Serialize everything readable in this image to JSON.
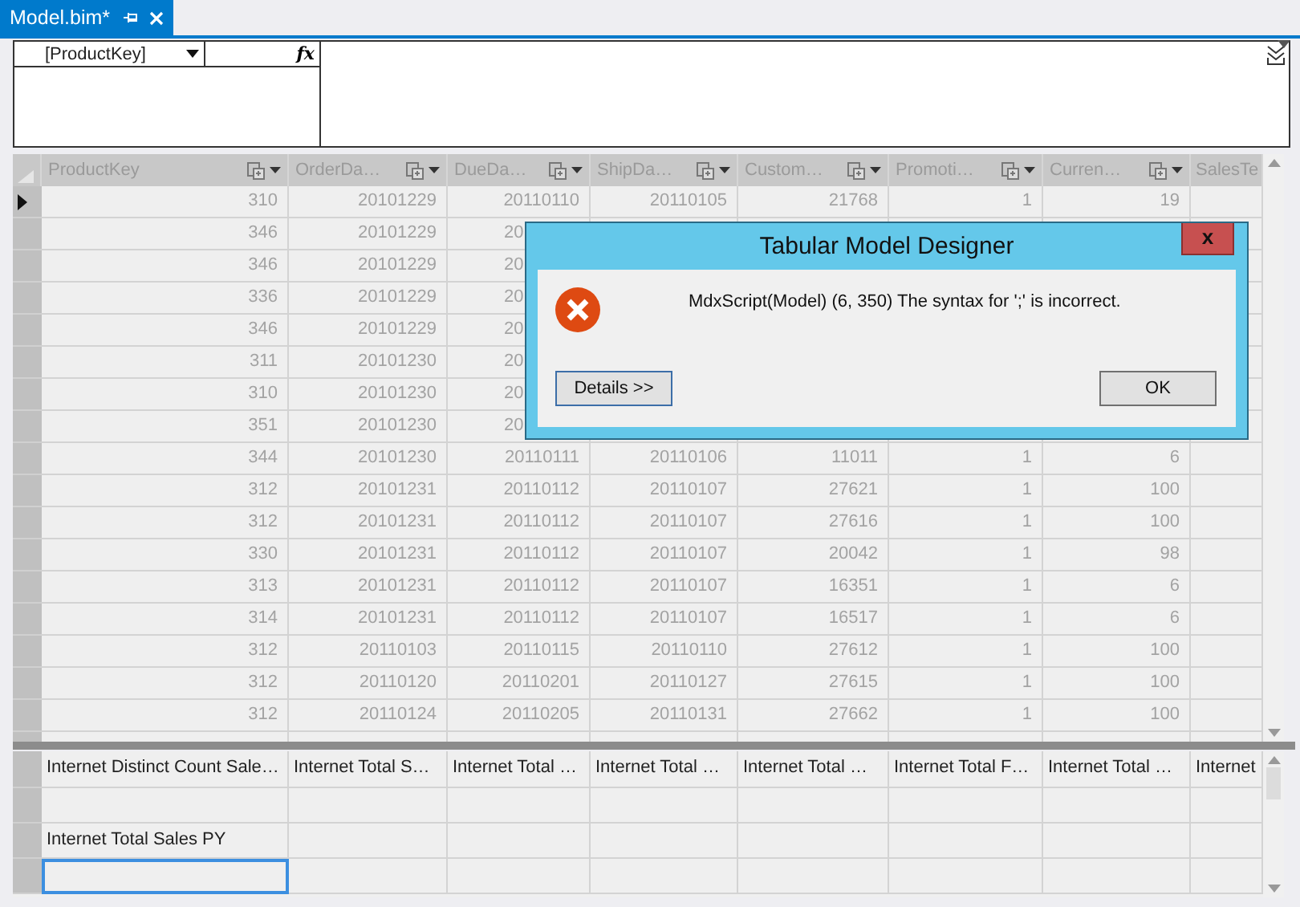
{
  "tab": {
    "title": "Model.bim*",
    "selected": true
  },
  "formula_bar": {
    "column_selector": "[ProductKey]",
    "fx": "fx"
  },
  "grid": {
    "columns": [
      "ProductKey",
      "OrderDa…",
      "DueDa…",
      "ShipDa…",
      "Custom…",
      "Promoti…",
      "Curren…",
      "SalesTe"
    ],
    "rows": [
      {
        "selected": true,
        "cells": [
          "310",
          "20101229",
          "20110110",
          "20110105",
          "21768",
          "1",
          "19"
        ]
      },
      {
        "selected": false,
        "cells": [
          "346",
          "20101229",
          "20"
        ]
      },
      {
        "selected": false,
        "cells": [
          "346",
          "20101229",
          "20"
        ]
      },
      {
        "selected": false,
        "cells": [
          "336",
          "20101229",
          "20"
        ]
      },
      {
        "selected": false,
        "cells": [
          "346",
          "20101229",
          "20"
        ]
      },
      {
        "selected": false,
        "cells": [
          "311",
          "20101230",
          "20"
        ]
      },
      {
        "selected": false,
        "cells": [
          "310",
          "20101230",
          "20"
        ]
      },
      {
        "selected": false,
        "cells": [
          "351",
          "20101230",
          "20"
        ]
      },
      {
        "selected": false,
        "cells": [
          "344",
          "20101230",
          "20110111",
          "20110106",
          "11011",
          "1",
          "6"
        ]
      },
      {
        "selected": false,
        "cells": [
          "312",
          "20101231",
          "20110112",
          "20110107",
          "27621",
          "1",
          "100"
        ]
      },
      {
        "selected": false,
        "cells": [
          "312",
          "20101231",
          "20110112",
          "20110107",
          "27616",
          "1",
          "100"
        ]
      },
      {
        "selected": false,
        "cells": [
          "330",
          "20101231",
          "20110112",
          "20110107",
          "20042",
          "1",
          "98"
        ]
      },
      {
        "selected": false,
        "cells": [
          "313",
          "20101231",
          "20110112",
          "20110107",
          "16351",
          "1",
          "6"
        ]
      },
      {
        "selected": false,
        "cells": [
          "314",
          "20101231",
          "20110112",
          "20110107",
          "16517",
          "1",
          "6"
        ]
      },
      {
        "selected": false,
        "cells": [
          "312",
          "20110103",
          "20110115",
          "20110110",
          "27612",
          "1",
          "100"
        ]
      },
      {
        "selected": false,
        "cells": [
          "312",
          "20110120",
          "20110201",
          "20110127",
          "27615",
          "1",
          "100"
        ]
      },
      {
        "selected": false,
        "cells": [
          "312",
          "20110124",
          "20110205",
          "20110131",
          "27662",
          "1",
          "100"
        ]
      }
    ]
  },
  "measure_grid": {
    "columns": [
      "Internet Distinct Count Sale…",
      "Internet Total S…",
      "Internet Total …",
      "Internet Total …",
      "Internet Total …",
      "Internet Total F…",
      "Internet Total …",
      "Internet"
    ],
    "rows": [
      {
        "selected": false
      },
      {
        "label": "Internet Total Sales PY",
        "selected": false
      },
      {
        "selected": true
      }
    ]
  },
  "dialog": {
    "title": "Tabular Model Designer",
    "close": "x",
    "message": "MdxScript(Model) (6, 350) The syntax for ';' is incorrect.",
    "buttons": [
      "Details >>",
      "OK"
    ]
  }
}
